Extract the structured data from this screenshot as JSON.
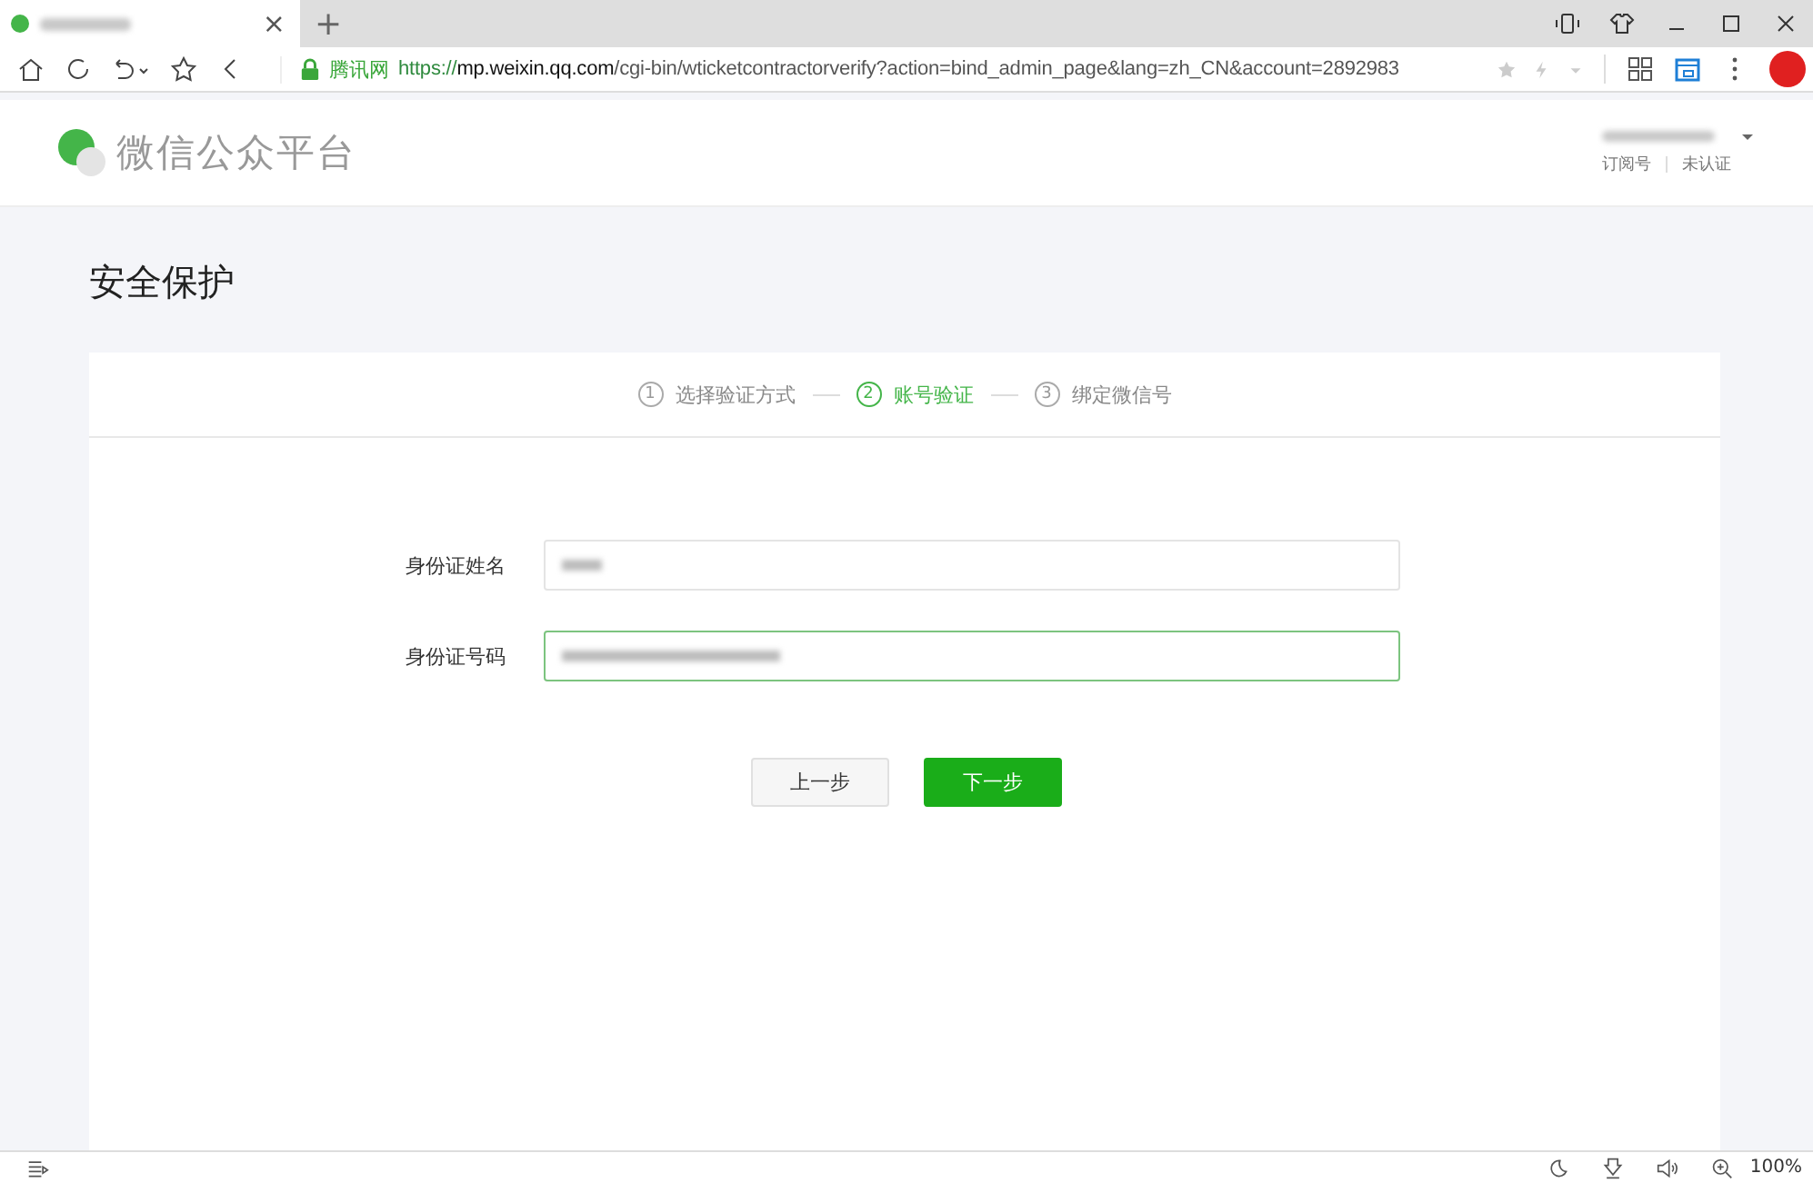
{
  "browser": {
    "tab": {
      "close": "×",
      "new_tab": "+"
    },
    "address": {
      "site_label": "腾讯网",
      "url_prefix": "https://",
      "url_host": "mp.weixin.qq.com",
      "url_path": "/cgi-bin/wticketcontractorverify?action=bind_admin_page&lang=zh_CN&account=2892983"
    }
  },
  "header": {
    "logo_text": "微信公众平台",
    "account_type": "订阅号",
    "account_status": "未认证"
  },
  "page_title": "安全保护",
  "steps": [
    {
      "number": "1",
      "label": "选择验证方式",
      "selected": false
    },
    {
      "number": "2",
      "label": "账号验证",
      "selected": true
    },
    {
      "number": "3",
      "label": "绑定微信号",
      "selected": false
    }
  ],
  "fields": [
    {
      "label": "身份证姓名",
      "focused": false
    },
    {
      "label": "身份证号码",
      "focused": true
    }
  ],
  "buttons": [
    {
      "label": "上一步",
      "kind": "secondary"
    },
    {
      "label": "下一步",
      "kind": "primary"
    }
  ],
  "status_bar": {
    "zoom": "100%"
  }
}
